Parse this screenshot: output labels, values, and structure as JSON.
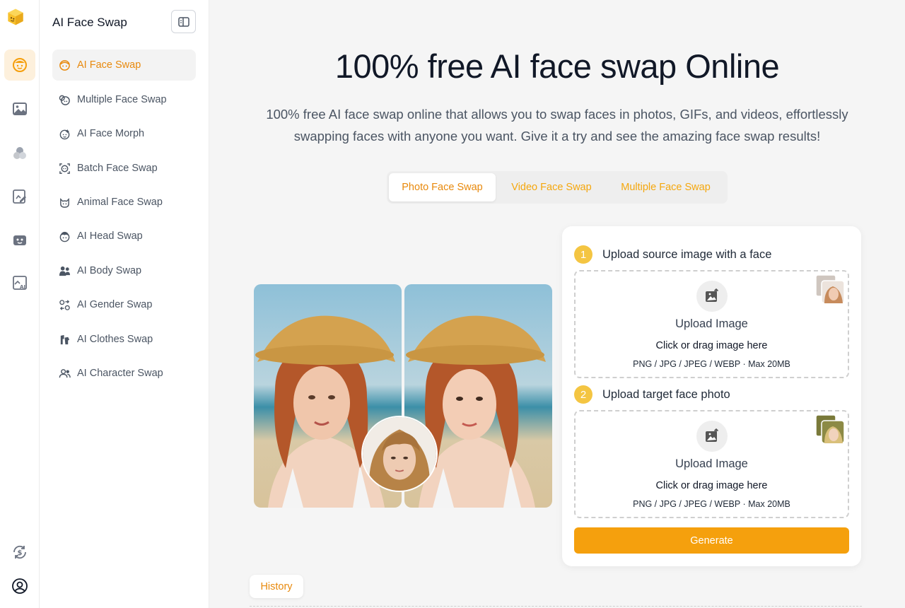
{
  "rail": {
    "items": [
      {
        "name": "face-swap-rail-item",
        "icon": "face-icon",
        "active": true
      },
      {
        "name": "image-rail-item",
        "icon": "image-icon",
        "active": false
      },
      {
        "name": "group-rail-item",
        "icon": "group-icon",
        "active": false
      },
      {
        "name": "edit-rail-item",
        "icon": "edit-icon",
        "active": false
      },
      {
        "name": "video-rail-item",
        "icon": "video-icon",
        "active": false
      },
      {
        "name": "ai-image-rail-item",
        "icon": "ai-image-icon",
        "active": false
      }
    ],
    "bottom": [
      {
        "name": "pricing-rail-item",
        "icon": "dollar-refresh-icon"
      },
      {
        "name": "account-rail-item",
        "icon": "user-circle-icon"
      }
    ]
  },
  "sidebar": {
    "title": "AI Face Swap",
    "items": [
      {
        "label": "AI Face Swap",
        "icon": "face-icon",
        "active": true
      },
      {
        "label": "Multiple Face Swap",
        "icon": "multi-face-icon",
        "active": false
      },
      {
        "label": "AI Face Morph",
        "icon": "morph-icon",
        "active": false
      },
      {
        "label": "Batch Face Swap",
        "icon": "batch-icon",
        "active": false
      },
      {
        "label": "Animal Face Swap",
        "icon": "cat-icon",
        "active": false
      },
      {
        "label": "AI Head Swap",
        "icon": "head-icon",
        "active": false
      },
      {
        "label": "AI Body Swap",
        "icon": "body-icon",
        "active": false
      },
      {
        "label": "AI Gender Swap",
        "icon": "gender-icon",
        "active": false
      },
      {
        "label": "AI Clothes Swap",
        "icon": "clothes-icon",
        "active": false
      },
      {
        "label": "AI Character Swap",
        "icon": "character-icon",
        "active": false
      }
    ]
  },
  "main": {
    "title": "100% free AI face swap Online",
    "subtitle": "100% free AI face swap online that allows you to swap faces in photos, GIFs, and videos, effortlessly swapping faces with anyone you want. Give it a try and see the amazing face swap results!",
    "tabs": [
      {
        "label": "Photo Face Swap",
        "active": true
      },
      {
        "label": "Video Face Swap",
        "active": false
      },
      {
        "label": "Multiple Face Swap",
        "active": false
      }
    ]
  },
  "upload": {
    "step1": {
      "number": "1",
      "label": "Upload source image with a face"
    },
    "step2": {
      "number": "2",
      "label": "Upload target face photo"
    },
    "dropzone": {
      "title": "Upload Image",
      "hint": "Click or drag image here",
      "formats": "PNG / JPG / JPEG / WEBP · Max 20MB"
    },
    "generate_label": "Generate"
  },
  "history": {
    "label": "History"
  },
  "colors": {
    "accent": "#f5a00d",
    "accent_text": "#e8890c",
    "active_bg": "#fdf0dc",
    "step_badge": "#f4c542"
  }
}
